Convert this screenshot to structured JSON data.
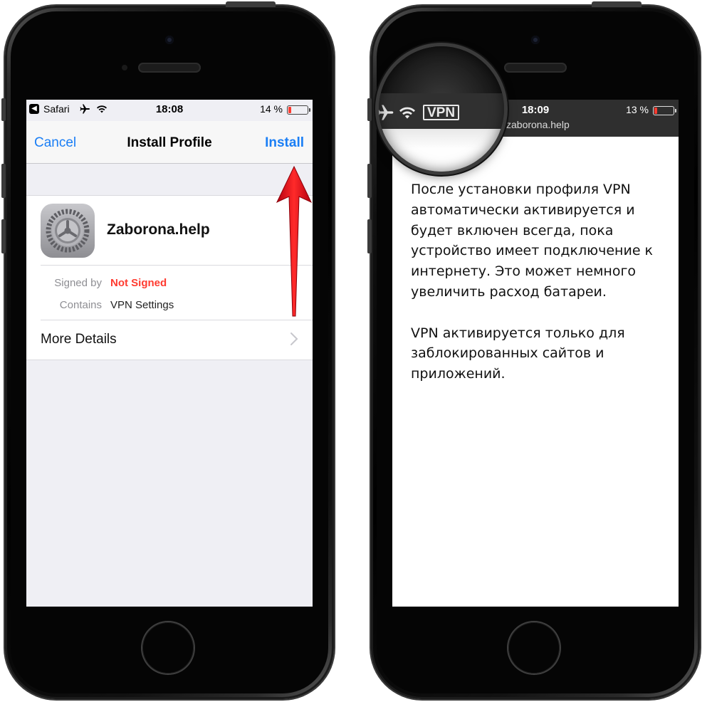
{
  "left_phone": {
    "status_bar": {
      "back_app": "Safari",
      "time": "18:08",
      "battery_percent": "14 %",
      "battery_color": "#ff3b30"
    },
    "nav": {
      "cancel": "Cancel",
      "title": "Install Profile",
      "install": "Install",
      "accent_color": "#1a7ef5"
    },
    "profile": {
      "icon": "settings-gear-icon",
      "name": "Zaborona.help",
      "signed_by_label": "Signed by",
      "signed_by_value": "Not Signed",
      "contains_label": "Contains",
      "contains_value": "VPN Settings",
      "more_details": "More Details"
    },
    "annotation": {
      "icon": "red-arrow-icon",
      "color": "#e30613"
    }
  },
  "right_phone": {
    "status_bar": {
      "time": "18:09",
      "battery_percent": "13 %",
      "url": "zaborona.help"
    },
    "magnifier": {
      "vpn_badge": "VPN",
      "icons": [
        "airplane-icon",
        "wifi-icon"
      ]
    },
    "content": {
      "paragraph_1": "После установки профиля VPN автоматически активируется и будет включен всегда, пока устройство имеет подключение к интернету. Это может немного увеличить расход батареи.",
      "paragraph_2": "VPN активируется только для заблокированных сайтов и приложений."
    }
  }
}
